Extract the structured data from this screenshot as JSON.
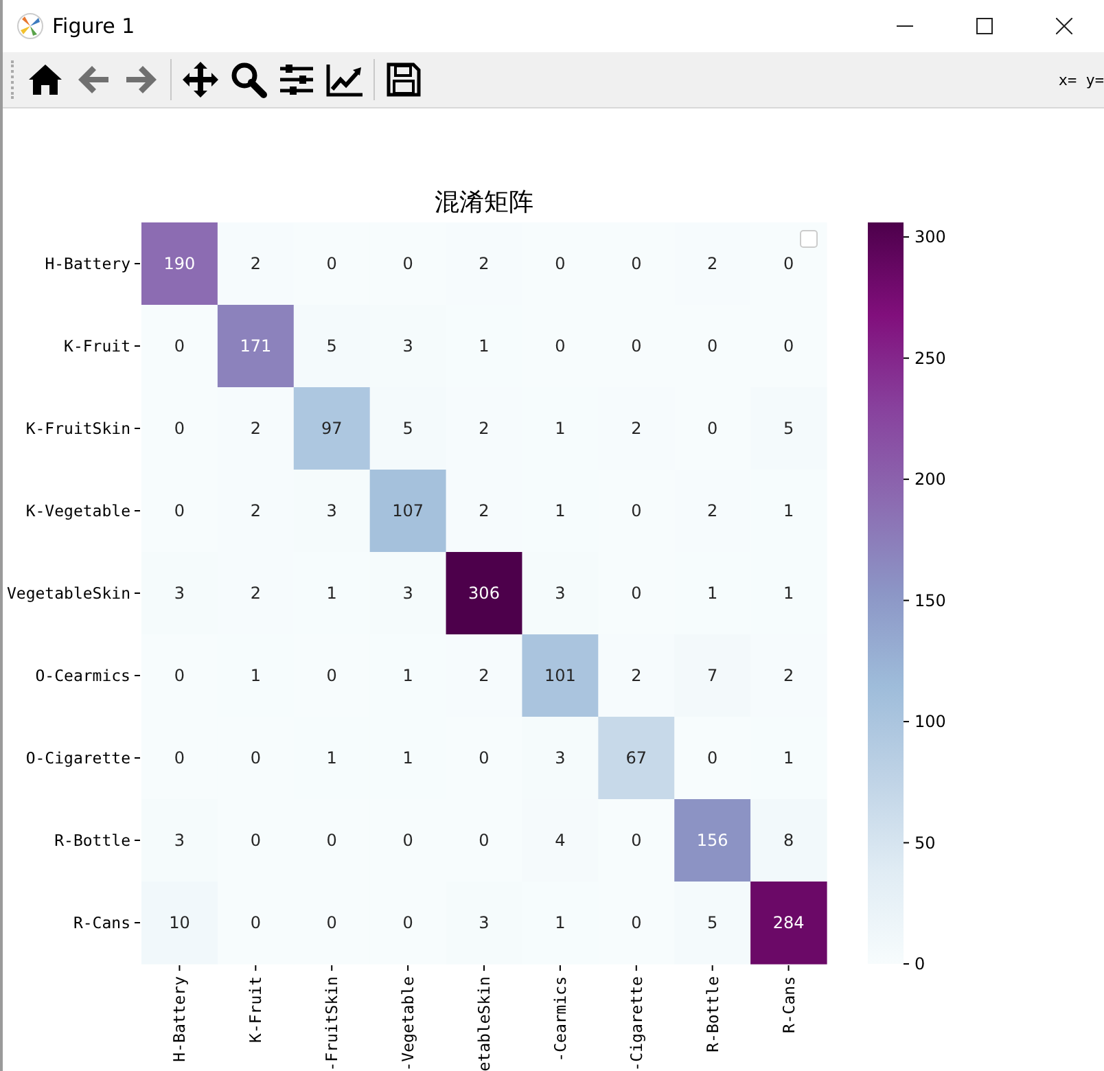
{
  "window": {
    "title": "Figure 1"
  },
  "toolbar": {
    "coordinates": "x= y="
  },
  "heatmap": {
    "title": "混淆矩阵",
    "row_labels": [
      "H-Battery",
      "K-Fruit",
      "K-FruitSkin",
      "K-Vegetable",
      "VegetableSkin",
      "O-Cearmics",
      "O-Cigarette",
      "R-Bottle",
      "R-Cans"
    ],
    "column_labels": [
      "H-Battery",
      "K-Fruit",
      "-FruitSkin",
      "-Vegetable",
      "etableSkin",
      "-Cearmics",
      "-Cigarette",
      "R-Bottle",
      "R-Cans"
    ],
    "rows": [
      [
        "190",
        "2",
        "0",
        "0",
        "2",
        "0",
        "0",
        "2",
        "0"
      ],
      [
        "0",
        "171",
        "5",
        "3",
        "1",
        "0",
        "0",
        "0",
        "0"
      ],
      [
        "0",
        "2",
        "97",
        "5",
        "2",
        "1",
        "2",
        "0",
        "5"
      ],
      [
        "0",
        "2",
        "3",
        "107",
        "2",
        "1",
        "0",
        "2",
        "1"
      ],
      [
        "3",
        "2",
        "1",
        "3",
        "306",
        "3",
        "0",
        "1",
        "1"
      ],
      [
        "0",
        "1",
        "0",
        "1",
        "2",
        "101",
        "2",
        "7",
        "2"
      ],
      [
        "0",
        "0",
        "1",
        "1",
        "0",
        "3",
        "67",
        "0",
        "1"
      ],
      [
        "3",
        "0",
        "0",
        "0",
        "0",
        "4",
        "0",
        "156",
        "8"
      ],
      [
        "10",
        "0",
        "0",
        "0",
        "3",
        "1",
        "0",
        "5",
        "284"
      ]
    ],
    "colorbar_ticks": [
      "300",
      "250",
      "200",
      "150",
      "100",
      "50",
      "0"
    ]
  }
}
